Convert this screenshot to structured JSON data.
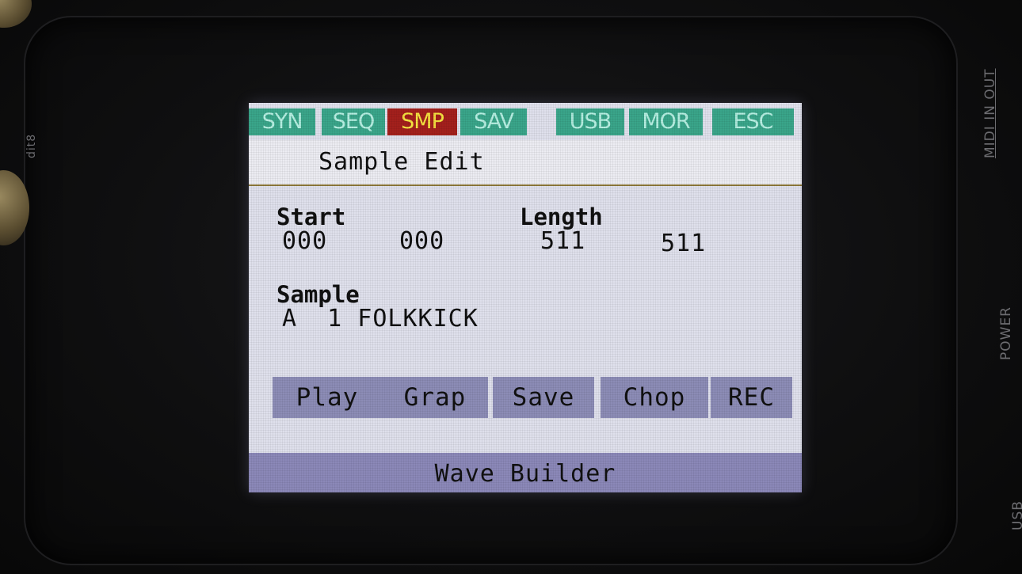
{
  "device": {
    "labels": {
      "midi_in_out": "MIDI IN OUT",
      "power": "POWER",
      "usb": "USB",
      "knob_label": "dit8"
    }
  },
  "tabs": [
    {
      "label": "SYN",
      "active": false
    },
    {
      "label": "SEQ",
      "active": false
    },
    {
      "label": "SMP",
      "active": true
    },
    {
      "label": "SAV",
      "active": false
    },
    {
      "label": "USB",
      "active": false
    },
    {
      "label": "MOR",
      "active": false
    },
    {
      "label": "ESC",
      "active": false
    }
  ],
  "page": {
    "title": "Sample Edit"
  },
  "params": {
    "start": {
      "label": "Start",
      "value_a": "000",
      "value_b": "000"
    },
    "length": {
      "label": "Length",
      "value_a": "511",
      "value_b": "511"
    },
    "sample": {
      "label": "Sample",
      "value": "A  1 FOLKKICK"
    }
  },
  "buttons": [
    "Play",
    "Grap",
    "Save",
    "Chop",
    "REC"
  ],
  "footer": {
    "label": "Wave Builder"
  },
  "colors": {
    "tab_bg": "#3aa58a",
    "tab_text": "#b6efe2",
    "active_tab_bg": "#a3201c",
    "active_tab_text": "#f6e440",
    "screen_bg": "#dfe0ec",
    "button_bg": "#8c8cb6",
    "footer_bg": "#8b88b8"
  }
}
